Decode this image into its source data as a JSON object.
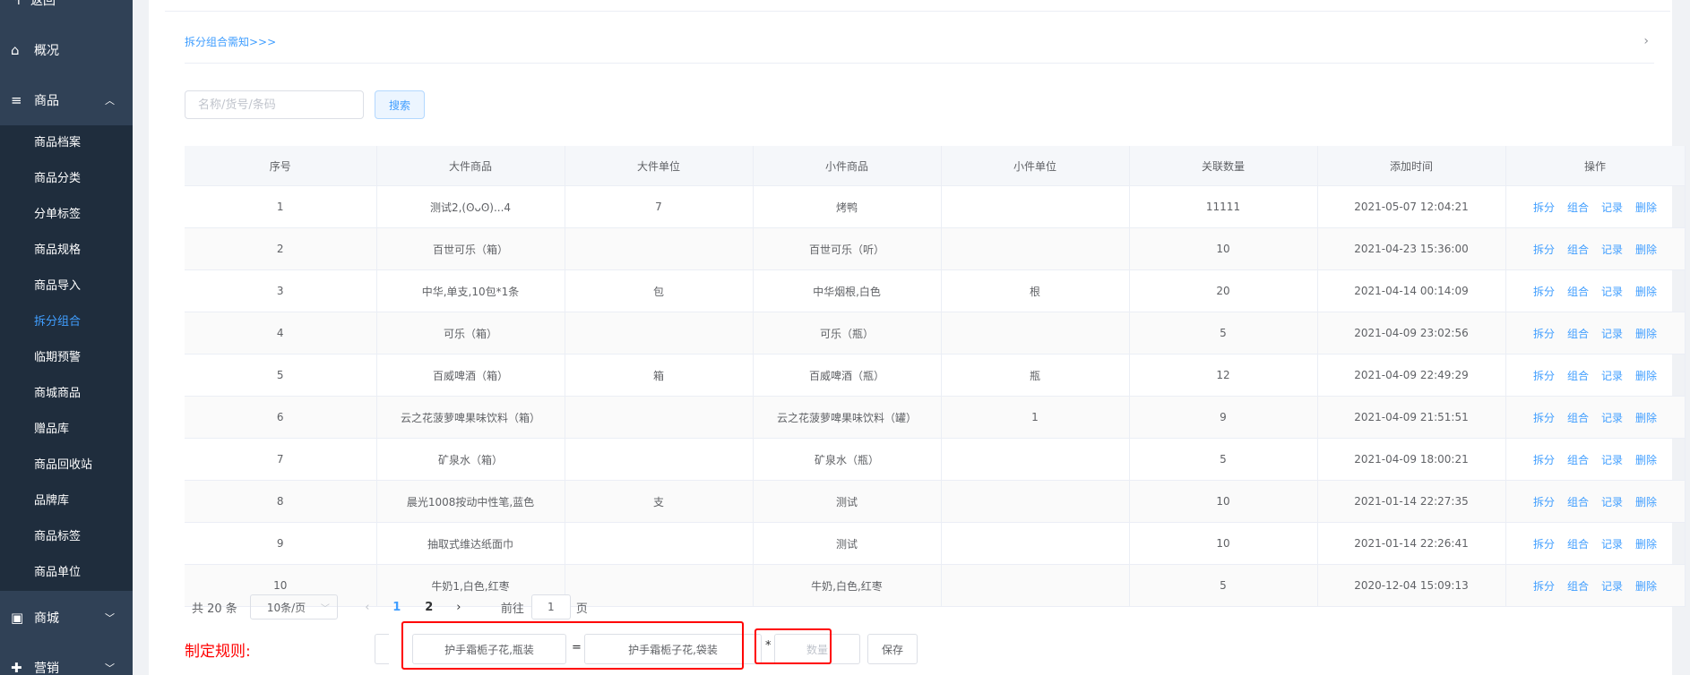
{
  "sidebar": {
    "back_label": "返回",
    "overview_label": "概况",
    "goods_label": "商品",
    "goods_items": [
      {
        "label": "商品档案",
        "active": false
      },
      {
        "label": "商品分类",
        "active": false
      },
      {
        "label": "分单标签",
        "active": false
      },
      {
        "label": "商品规格",
        "active": false
      },
      {
        "label": "商品导入",
        "active": false
      },
      {
        "label": "拆分组合",
        "active": true
      },
      {
        "label": "临期预警",
        "active": false
      },
      {
        "label": "商城商品",
        "active": false
      },
      {
        "label": "赠品库",
        "active": false
      },
      {
        "label": "商品回收站",
        "active": false
      },
      {
        "label": "品牌库",
        "active": false
      },
      {
        "label": "商品标签",
        "active": false
      },
      {
        "label": "商品单位",
        "active": false
      }
    ],
    "mall_label": "商城",
    "marketing_label": "营销"
  },
  "notice": {
    "link": "拆分组合需知>>>"
  },
  "search": {
    "placeholder": "名称/货号/条码",
    "button": "搜索"
  },
  "table": {
    "headers": [
      "序号",
      "大件商品",
      "大件单位",
      "小件商品",
      "小件单位",
      "关联数量",
      "添加时间",
      "操作"
    ],
    "actions": [
      "拆分",
      "组合",
      "记录",
      "删除"
    ],
    "rows": [
      [
        "1",
        "测试2,(ʘᴗʘ)...4",
        "7",
        "烤鸭",
        "",
        "11111",
        "2021-05-07 12:04:21"
      ],
      [
        "2",
        "百世可乐（箱）",
        "",
        "百世可乐（听）",
        "",
        "10",
        "2021-04-23 15:36:00"
      ],
      [
        "3",
        "中华,单支,10包*1条",
        "包",
        "中华烟根,白色",
        "根",
        "20",
        "2021-04-14 00:14:09"
      ],
      [
        "4",
        "可乐（箱）",
        "",
        "可乐（瓶）",
        "",
        "5",
        "2021-04-09 23:02:56"
      ],
      [
        "5",
        "百威啤酒（箱）",
        "箱",
        "百威啤酒（瓶）",
        "瓶",
        "12",
        "2021-04-09 22:49:29"
      ],
      [
        "6",
        "云之花菠萝啤果味饮料（箱）",
        "",
        "云之花菠萝啤果味饮料（罐）",
        "1",
        "9",
        "2021-04-09 21:51:51"
      ],
      [
        "7",
        "矿泉水（箱）",
        "",
        "矿泉水（瓶）",
        "",
        "5",
        "2021-04-09 18:00:21"
      ],
      [
        "8",
        "晨光1008按动中性笔,蓝色",
        "支",
        "测试",
        "",
        "10",
        "2021-01-14 22:27:35"
      ],
      [
        "9",
        "抽取式维达纸面巾",
        "",
        "测试",
        "",
        "10",
        "2021-01-14 22:26:41"
      ],
      [
        "10",
        "牛奶1,白色,红枣",
        "",
        "牛奶,白色,红枣",
        "",
        "5",
        "2020-12-04 15:09:13"
      ]
    ]
  },
  "pager": {
    "total": "共 20 条",
    "page_size": "10条/页",
    "pages": [
      "1",
      "2"
    ],
    "current": "1",
    "goto_label": "前往",
    "goto_value": "1",
    "page_word": "页"
  },
  "rule": {
    "label": "制定规则:",
    "big_item": "护手霜栀子花,瓶装",
    "equals": "=",
    "small_item": "护手霜栀子花,袋装",
    "star": "*",
    "qty_placeholder": "数量",
    "save": "保存"
  },
  "colors": {
    "sidebar_bg": "#304156",
    "submenu_bg": "#1f2d3d",
    "accent": "#409eff",
    "highlight": "#ff0000"
  }
}
